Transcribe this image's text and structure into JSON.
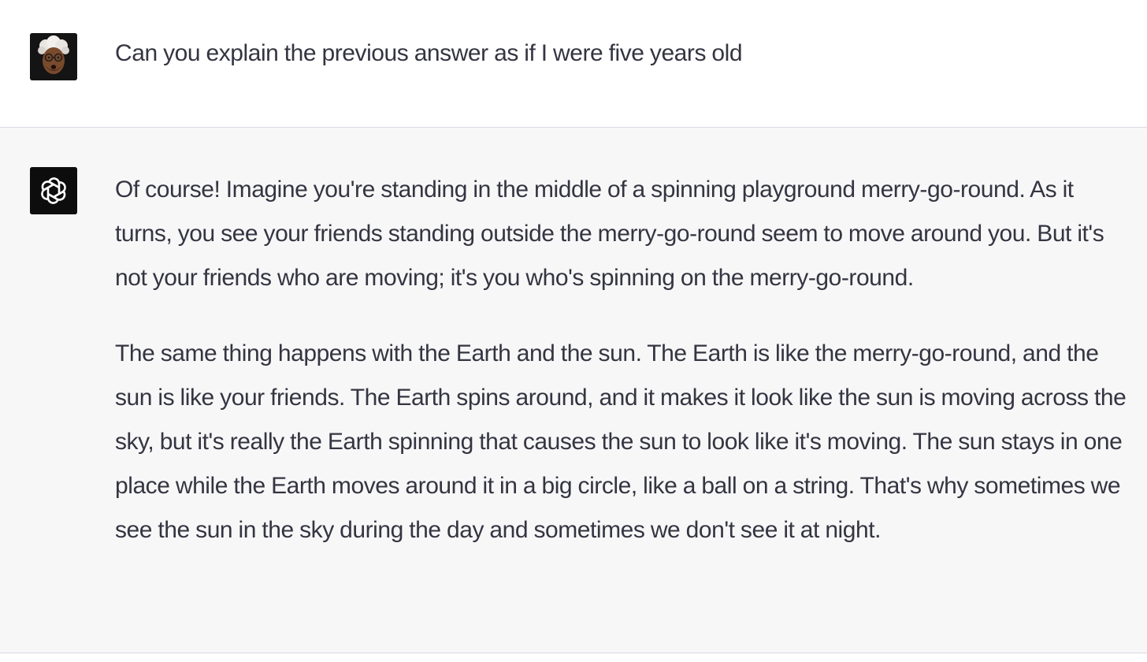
{
  "conversation": {
    "user_message": "Can you explain the previous answer as if I were five years old",
    "assistant_paragraphs": [
      "Of course! Imagine you're standing in the middle of a spinning playground merry-go-round. As it turns, you see your friends standing outside the merry-go-round seem to move around you. But it's not your friends who are moving; it's you who's spinning on the merry-go-round.",
      "The same thing happens with the Earth and the sun. The Earth is like the merry-go-round, and the sun is like your friends. The Earth spins around, and it makes it look like the sun is moving across the sky, but it's really the Earth spinning that causes the sun to look like it's moving. The sun stays in one place while the Earth moves around it in a big circle, like a ball on a string. That's why sometimes we see the sun in the sky during the day and sometimes we don't see it at night."
    ]
  },
  "icons": {
    "user_avatar": "user-avatar-icon",
    "assistant_avatar": "openai-logo-icon"
  },
  "colors": {
    "user_bg": "#ffffff",
    "assistant_bg": "#f7f7f8",
    "text": "#343541",
    "divider": "#d9d9e3"
  }
}
